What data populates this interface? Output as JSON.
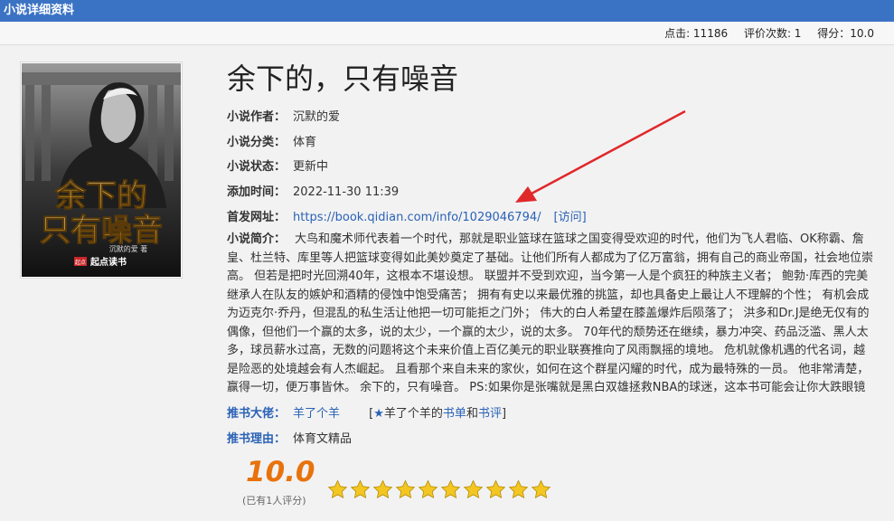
{
  "header": {
    "title": "小说详细资料"
  },
  "stats": {
    "clicks": "点击: 11186",
    "ratings": "评价次数: 1",
    "score": "得分：10.0"
  },
  "cover": {
    "title_line1": "余下的",
    "title_line2": "只有噪音",
    "author_tag": "沉默的爱 著",
    "publisher_badge": "起点",
    "publisher": "起点读书"
  },
  "book": {
    "title": "余下的，只有噪音",
    "author_label": "小说作者：",
    "author": "沉默的爱",
    "category_label": "小说分类：",
    "category": "体育",
    "status_label": "小说状态：",
    "status": "更新中",
    "added_label": "添加时间：",
    "added": "2022-11-30 11:39",
    "url_label": "首发网址：",
    "url": "https://book.qidian.com/info/1029046794/",
    "visit": "[访问]",
    "intro_label": "小说简介：",
    "intro": "大鸟和魔术师代表着一个时代，那就是职业篮球在篮球之国变得受欢迎的时代，他们为飞人君临、OK称霸、詹皇、杜兰特、库里等人把篮球变得如此美妙奠定了基础。让他们所有人都成为了亿万富翁，拥有自己的商业帝国，社会地位崇高。 但若是把时光回溯40年，这根本不堪设想。 联盟并不受到欢迎，当今第一人是个疯狂的种族主义者； 鲍勃·库西的完美继承人在队友的嫉妒和酒精的侵蚀中饱受痛苦； 拥有有史以来最优雅的挑篮，却也具备史上最让人不理解的个性； 有机会成为迈克尔·乔丹，但混乱的私生活让他把一切可能拒之门外； 伟大的白人希望在膝盖爆炸后陨落了； 洪多和Dr.J是绝无仅有的偶像，但他们一个赢的太多，说的太少，一个赢的太少，说的太多。 70年代的颓势还在继续，暴力冲突、药品泛滥、黑人太多，球员薪水过高，无数的问题将这个未来价值上百亿美元的职业联赛推向了风雨飘摇的境地。 危机就像机遇的代名词，越是险恶的处境越会有人杰崛起。 且看那个来自未来的家伙，如何在这个群星闪耀的时代，成为最特殊的一员。 他非常清楚，赢得一切，便万事皆休。 余下的，只有噪音。 PS:如果你是张嘴就是黑白双雄拯救NBA的球迷，这本书可能会让你大跌眼镜",
    "recommender_label": "推书大佬：",
    "recommender": "羊了个羊",
    "recommender_lists_prefix": "羊了个羊的",
    "booklist": "书单",
    "and": "和",
    "reviews": "书评",
    "reason_label": "推书理由：",
    "reason": "体育文精品",
    "score_big": "10.0",
    "score_note": "(已有1人评分)",
    "stars_filled": 10,
    "stars_total": 10
  },
  "colors": {
    "header": "#3b73c4",
    "link": "#2a62b6",
    "score": "#e8730c",
    "star": "#f3c623",
    "arrow": "#e0282a"
  }
}
